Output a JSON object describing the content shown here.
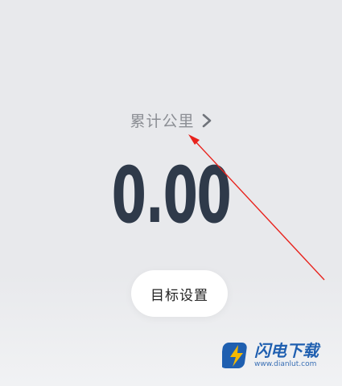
{
  "stats": {
    "total_label": "累计公里",
    "distance_value": "0.00"
  },
  "actions": {
    "goal_label": "目标设置"
  },
  "watermark": {
    "brand": "闪电下载",
    "url": "www.dianlut.com"
  },
  "colors": {
    "background": "#e8e9ec",
    "distance": "#2f3a4a",
    "label": "#8b8e94",
    "annotation_arrow": "#e8231d",
    "watermark_blue": "#1f5fb0",
    "watermark_yellow": "#f5b800"
  },
  "icons": {
    "total_chevron": "chevron-right-icon",
    "watermark_logo": "lightning-logo-icon"
  }
}
